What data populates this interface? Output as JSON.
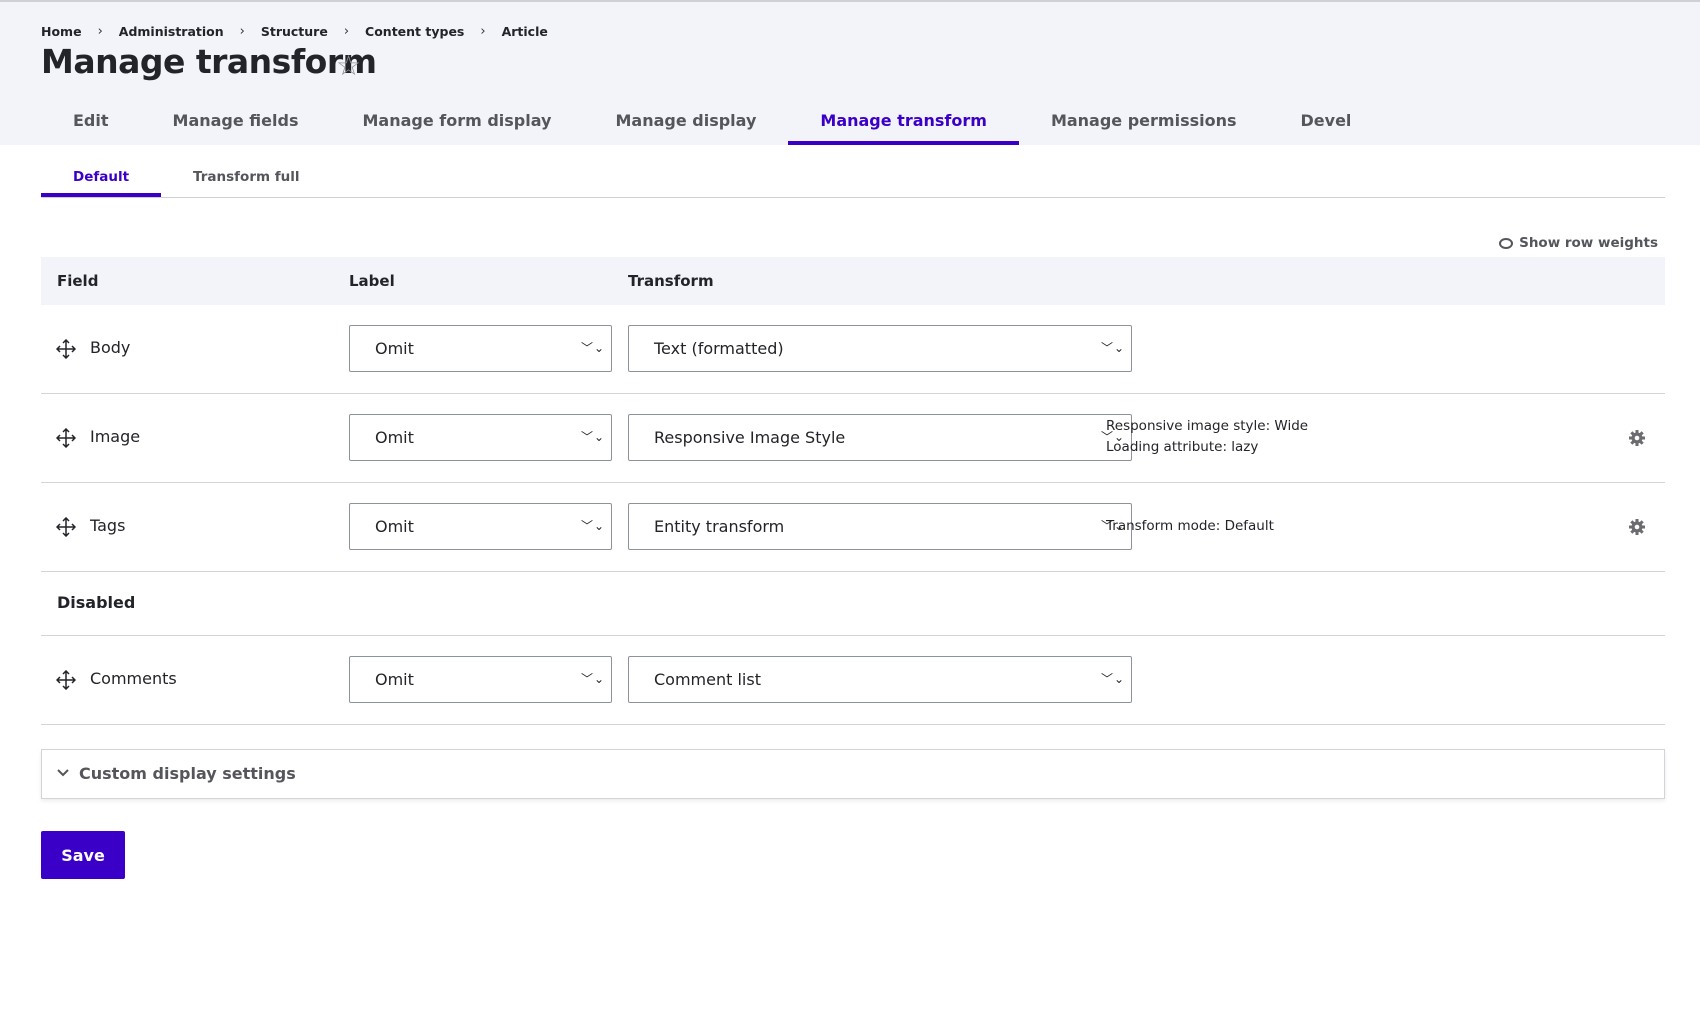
{
  "breadcrumb": [
    "Home",
    "Administration",
    "Structure",
    "Content types",
    "Article"
  ],
  "page_title": "Manage transform",
  "primary_tabs": [
    {
      "label": "Edit",
      "active": false
    },
    {
      "label": "Manage fields",
      "active": false
    },
    {
      "label": "Manage form display",
      "active": false
    },
    {
      "label": "Manage display",
      "active": false
    },
    {
      "label": "Manage transform",
      "active": true
    },
    {
      "label": "Manage permissions",
      "active": false
    },
    {
      "label": "Devel",
      "active": false
    }
  ],
  "secondary_tabs": [
    {
      "label": "Default",
      "active": true
    },
    {
      "label": "Transform full",
      "active": false
    }
  ],
  "show_row_weights": "Show row weights",
  "table": {
    "headers": {
      "field": "Field",
      "label": "Label",
      "transform": "Transform"
    },
    "rows": [
      {
        "field": "Body",
        "label": "Omit",
        "transform": "Text (formatted)",
        "summary": [],
        "has_settings": false
      },
      {
        "field": "Image",
        "label": "Omit",
        "transform": "Responsive Image Style",
        "summary": [
          "Responsive image style: Wide",
          "Loading attribute: lazy"
        ],
        "has_settings": true
      },
      {
        "field": "Tags",
        "label": "Omit",
        "transform": "Entity transform",
        "summary": [
          "Transform mode: Default"
        ],
        "has_settings": true
      }
    ],
    "disabled_label": "Disabled",
    "disabled_rows": [
      {
        "field": "Comments",
        "label": "Omit",
        "transform": "Comment list"
      }
    ]
  },
  "custom_display_settings": "Custom display settings",
  "save_label": "Save",
  "colors": {
    "accent": "#3b00c8",
    "header_bg": "#f3f4f9",
    "text": "#232429",
    "muted": "#55565b"
  }
}
